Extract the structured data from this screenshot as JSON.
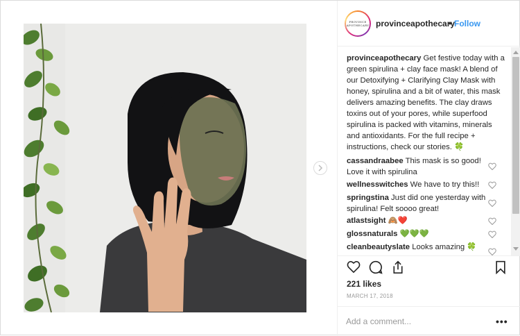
{
  "post": {
    "username": "provinceapothecary",
    "separator": "•",
    "follow_label": "Follow",
    "avatar_text_line1": "PROVINCE",
    "avatar_text_line2": "APOTHECARY",
    "image_alt": "Woman applying green spirulina clay face mask"
  },
  "caption": {
    "username": "provinceapothecary",
    "text": " Get festive today with a green spirulina + clay face mask! A blend of our Detoxifying + Clarifying Clay Mask with honey, spirulina and a bit of water, this mask delivers amazing benefits. The clay draws toxins out of your pores, while superfood spirulina is packed with vitamins, minerals and antioxidants. For the full recipe + instructions, check our stories. 🍀"
  },
  "comments": [
    {
      "username": "cassandraabee",
      "text": " This mask is so good! Love it with spirulina"
    },
    {
      "username": "wellnesswitches",
      "text": " We have to try this!!"
    },
    {
      "username": "springstina",
      "text": " Just did one yesterday with spirulina! Felt soooo great!"
    },
    {
      "username": "atlastsight",
      "text": " 🙈❤️"
    },
    {
      "username": "glossnaturals",
      "text": " 💚💚💚"
    },
    {
      "username": "cleanbeautyslate",
      "text": " Looks amazing 🍀"
    }
  ],
  "likes": "221 likes",
  "date": "MARCH 17, 2018",
  "add_comment": {
    "placeholder": "Add a comment..."
  },
  "more_label": "•••",
  "colors": {
    "link": "#3897f0",
    "text": "#262626",
    "muted": "#999999",
    "border": "#efefef"
  },
  "icons": [
    "heart-icon",
    "comment-icon",
    "share-icon",
    "bookmark-icon",
    "chevron-right-icon",
    "like-comment-heart-icon"
  ]
}
